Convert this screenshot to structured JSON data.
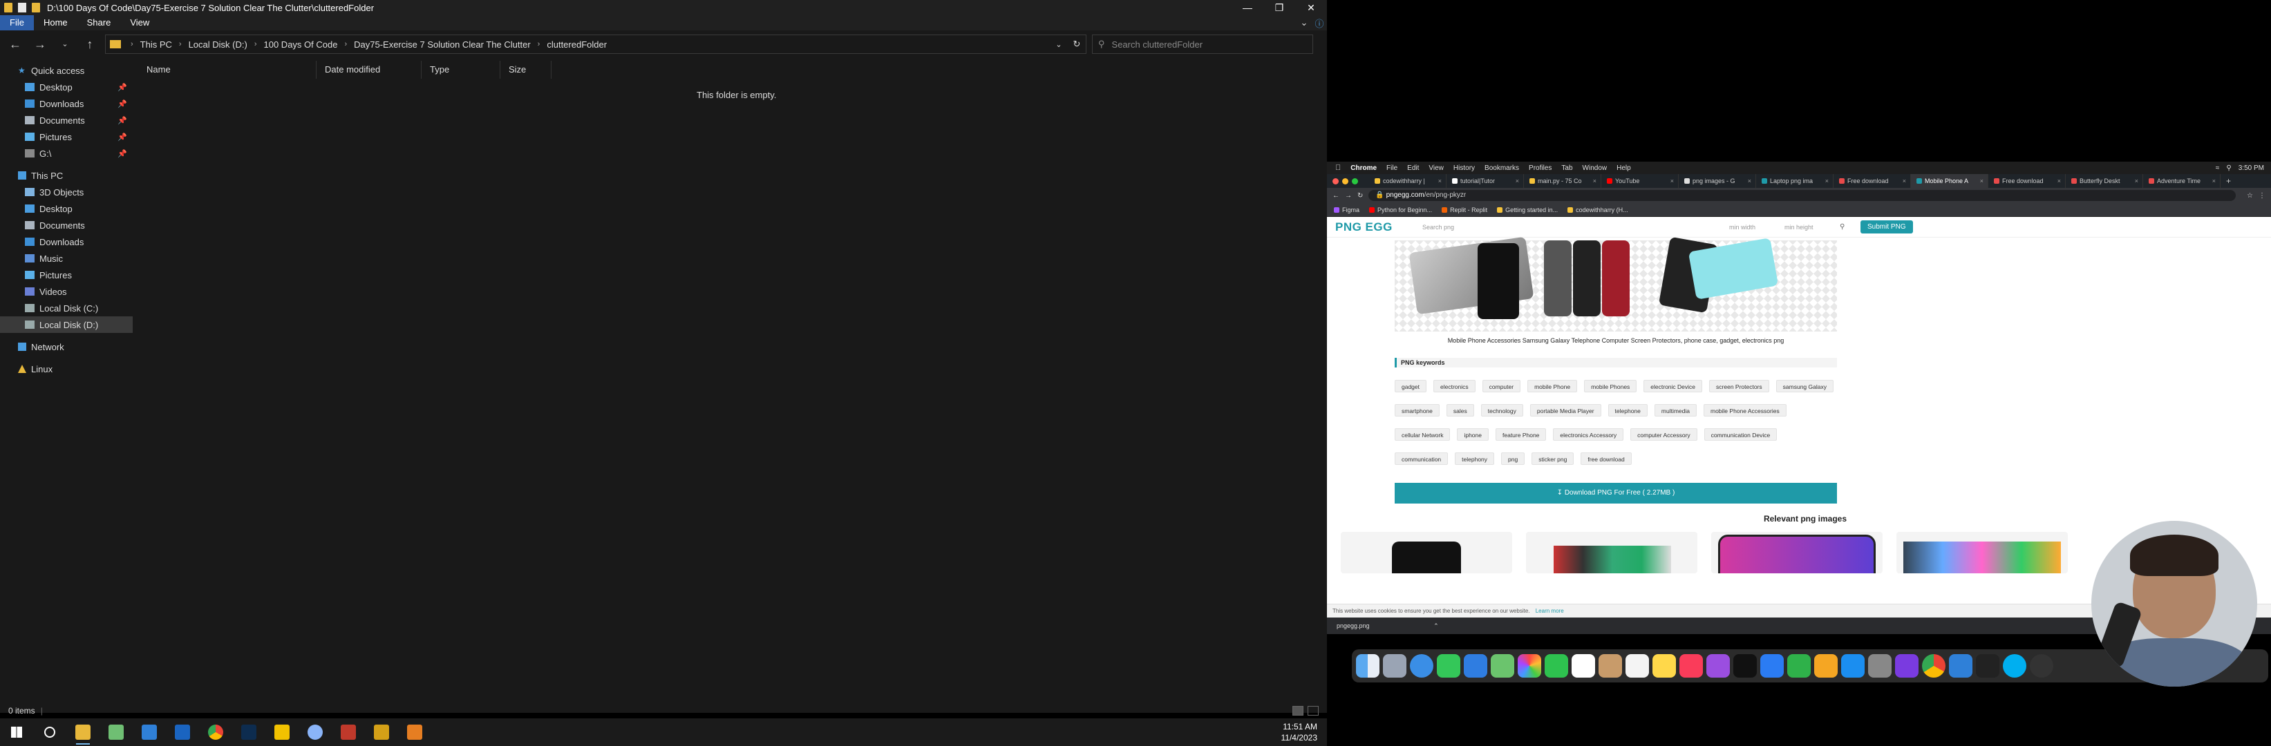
{
  "explorer": {
    "title": "D:\\100 Days Of Code\\Day75-Exercise 7 Solution Clear The Clutter\\clutteredFolder",
    "ribbon_tabs": [
      "File",
      "Home",
      "Share",
      "View"
    ],
    "breadcrumb": [
      "This PC",
      "Local Disk (D:)",
      "100 Days Of Code",
      "Day75-Exercise 7 Solution Clear The Clutter",
      "clutteredFolder"
    ],
    "search_placeholder": "Search clutteredFolder",
    "nav": {
      "quick_access": "Quick access",
      "qa_items": [
        "Desktop",
        "Downloads",
        "Documents",
        "Pictures",
        "G:\\"
      ],
      "this_pc": "This PC",
      "pc_items": [
        "3D Objects",
        "Desktop",
        "Documents",
        "Downloads",
        "Music",
        "Pictures",
        "Videos",
        "Local Disk (C:)",
        "Local Disk (D:)"
      ],
      "network": "Network",
      "linux": "Linux"
    },
    "columns": [
      "Name",
      "Date modified",
      "Type",
      "Size"
    ],
    "empty_message": "This folder is empty.",
    "status": "0 items"
  },
  "taskbar": {
    "time": "11:51 AM",
    "date": "11/4/2023"
  },
  "mac": {
    "menubar": [
      "Chrome",
      "File",
      "Edit",
      "View",
      "History",
      "Bookmarks",
      "Profiles",
      "Tab",
      "Window",
      "Help"
    ],
    "clock": "3:50 PM",
    "tabs": [
      "codewithharry |",
      "tutorial|Tutor",
      "main.py - 75 Co",
      "YouTube",
      "png images - G",
      "Laptop png ima",
      "Free download",
      "Mobile Phone A",
      "Free download",
      "Butterfly Deskt",
      "Adventure Time"
    ],
    "url_domain": "pngegg.com",
    "url_path": "/en/png-pkyzr",
    "bookmarks": [
      "Figma",
      "Python for Beginn...",
      "Replit - Replit",
      "Getting started in...",
      "codewithharry (H..."
    ],
    "site": {
      "logo": "PNG EGG",
      "search_placeholder": "Search png",
      "min_width": "min width",
      "min_height": "min height",
      "submit": "Submit PNG",
      "caption": "Mobile Phone Accessories Samsung Galaxy Telephone Computer Screen Protectors, phone case, gadget, electronics png",
      "keywords_title": "PNG keywords",
      "keywords": [
        "gadget",
        "electronics",
        "computer",
        "mobile Phone",
        "mobile Phones",
        "electronic Device",
        "screen Protectors",
        "samsung Galaxy",
        "smartphone",
        "sales",
        "technology",
        "portable Media Player",
        "telephone",
        "multimedia",
        "mobile Phone Accessories",
        "cellular Network",
        "iphone",
        "feature Phone",
        "electronics Accessory",
        "computer Accessory",
        "communication Device",
        "communication",
        "telephony",
        "png",
        "sticker png",
        "free download"
      ],
      "download": "Download PNG For Free ( 2.27MB )",
      "relevant": "Relevant png images",
      "cookie": "This website uses cookies to ensure you get the best experience on our website.",
      "learn_more": "Learn more"
    },
    "download_file": "pngegg.png"
  },
  "colors": {
    "accent_teal": "#1f9aa8",
    "explorer_bg": "#191919",
    "selection_blue": "#2d5ea8"
  }
}
